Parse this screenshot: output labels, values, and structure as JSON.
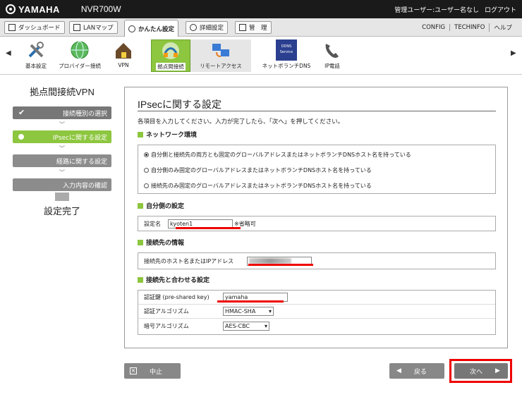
{
  "header": {
    "brand": "YAMAHA",
    "model": "NVR700W",
    "user_label": "管理ユーザー:ユーザー名なし",
    "logout": "ログアウト"
  },
  "tabs": [
    {
      "label": "ダッシュボード"
    },
    {
      "label": "LANマップ"
    },
    {
      "label": "かんたん設定"
    },
    {
      "label": "詳細設定"
    },
    {
      "label": "管　理"
    }
  ],
  "top_links": [
    "CONFIG",
    "TECHINFO",
    "ヘルプ"
  ],
  "features": [
    {
      "label": "基本設定",
      "icon": "tools-icon"
    },
    {
      "label": "プロバイダー接続",
      "icon": "globe-icon"
    },
    {
      "label": "VPN",
      "icon": "vpn-house-icon"
    },
    {
      "label": "拠点間接続",
      "icon": "site-link-icon"
    },
    {
      "label": "リモートアクセス",
      "icon": "remote-access-icon"
    },
    {
      "label": "ネットボランチDNS",
      "icon": "ddns-icon",
      "badge": "DDNS Service"
    },
    {
      "label": "IP電話",
      "icon": "phone-icon"
    }
  ],
  "wizard": {
    "title": "拠点間接続VPN",
    "steps": [
      {
        "label": "接続種別の選択",
        "state": "done"
      },
      {
        "label": "IPsecに関する設定",
        "state": "current"
      },
      {
        "label": "経路に関する設定",
        "state": "todo"
      },
      {
        "label": "入力内容の確認",
        "state": "todo"
      }
    ],
    "finish": "設定完了"
  },
  "main": {
    "title": "IPsecに関する設定",
    "instruction": "各項目を入力してください。入力が完了したら、「次へ」を押してください。",
    "network": {
      "heading": "ネットワーク環境",
      "options": [
        {
          "label": "自分側と接続先の両方とも固定のグローバルアドレスまたはネットボランチDNSホスト名を持っている",
          "selected": true
        },
        {
          "label": "自分側のみ固定のグローバルアドレスまたはネットボランチDNSホスト名を持っている",
          "selected": false
        },
        {
          "label": "接続先のみ固定のグローバルアドレスまたはネットボランチDNSホスト名を持っている",
          "selected": false
        }
      ]
    },
    "self": {
      "heading": "自分側の設定",
      "name_label": "設定名",
      "name_value": "kyoten1",
      "name_note": "※省略可"
    },
    "peer": {
      "heading": "接続先の情報",
      "host_label": "接続先のホスト名またはIPアドレス"
    },
    "match": {
      "heading": "接続先と合わせる設定",
      "psk_label": "認証鍵 (pre-shared key)",
      "psk_value": "yamaha",
      "auth_label": "認証アルゴリズム",
      "auth_value": "HMAC-SHA",
      "enc_label": "暗号アルゴリズム",
      "enc_value": "AES-CBC"
    }
  },
  "buttons": {
    "cancel": "中止",
    "back": "戻る",
    "next": "次へ"
  },
  "colors": {
    "accent": "#8dc63f",
    "highlight": "#e00000",
    "topbar": "#1a1a1a"
  }
}
